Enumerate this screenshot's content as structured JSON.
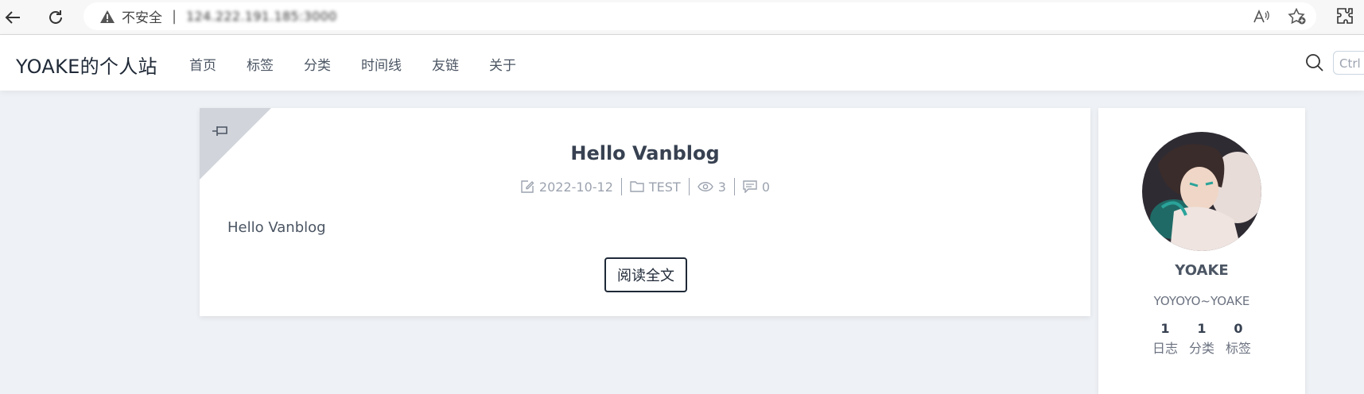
{
  "browser": {
    "security_label": "不安全",
    "separator": "|",
    "url": "124.222.191.185:3000"
  },
  "site": {
    "brand": "YOAKE的个人站",
    "menu": [
      "首页",
      "标签",
      "分类",
      "时间线",
      "友链",
      "关于"
    ],
    "search_placeholder": "Ctrl"
  },
  "post": {
    "title": "Hello Vanblog",
    "date": "2022-10-12",
    "category": "TEST",
    "views": "3",
    "comments": "0",
    "excerpt": "Hello Vanblog",
    "read_more": "阅读全文"
  },
  "author": {
    "name": "YOAKE",
    "description": "YOYOYO~YOAKE",
    "stats": [
      {
        "value": "1",
        "label": "日志"
      },
      {
        "value": "1",
        "label": "分类"
      },
      {
        "value": "0",
        "label": "标签"
      }
    ]
  },
  "colors": {
    "page_bg": "#eef1f5",
    "card_bg": "#ffffff",
    "pin_corner": "#d1d5db",
    "muted_text": "#9ca3af"
  },
  "icons": [
    "back-icon",
    "refresh-icon",
    "warning-icon",
    "read-aloud-icon",
    "favorite-add-icon",
    "extensions-icon",
    "search-icon",
    "pin-icon",
    "edit-icon",
    "folder-icon",
    "eye-icon",
    "comment-icon"
  ]
}
